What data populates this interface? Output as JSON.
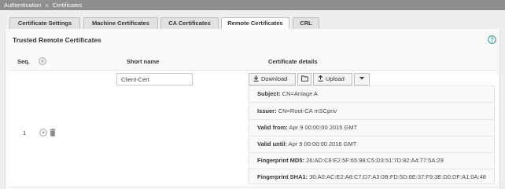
{
  "breadcrumb": {
    "items": [
      "Authentication",
      "Certificates"
    ],
    "separator": "»"
  },
  "tabs": [
    {
      "label": "Certificate Settings",
      "active": false
    },
    {
      "label": "Machine Certificates",
      "active": false
    },
    {
      "label": "CA Certificates",
      "active": false
    },
    {
      "label": "Remote Certificates",
      "active": true
    },
    {
      "label": "CRL",
      "active": false
    }
  ],
  "section": {
    "title": "Trusted Remote Certificates"
  },
  "columns": {
    "seq": "Seq.",
    "short_name": "Short name",
    "details": "Certificate details"
  },
  "row": {
    "seq": "1",
    "short_name": "Client-Cert",
    "buttons": {
      "download": "Download",
      "upload": "Upload"
    },
    "details": {
      "subject_label": "Subject:",
      "subject_value": " CN=Anlage A",
      "issuer_label": "Issuer:",
      "issuer_value": " CN=Root-CA mSCpriv",
      "valid_from_label": "Valid from:",
      "valid_from_value": " Apr 9 00:00:00 2015 GMT",
      "valid_until_label": "Valid until:",
      "valid_until_value": " Apr 9 00:00:00 2016 GMT",
      "md5_label": "Fingerprint MD5:",
      "md5_value": " 26:AD:C8:E2:5F:65:98:C5:D3:51:7D:82:A4:77:5A:29",
      "sha1_label": "Fingerprint SHA1:",
      "sha1_value": " 30:A0:AC:E2:A8:C7:D7:A3:0B:FD:5D:6E:37:F9:3E:D0:DF:A1:0A:48"
    }
  },
  "colors": {
    "breadcrumb_bg": "#8e8e8e",
    "help_icon": "#2e9e96",
    "tab_active_bg": "#ffffff"
  }
}
